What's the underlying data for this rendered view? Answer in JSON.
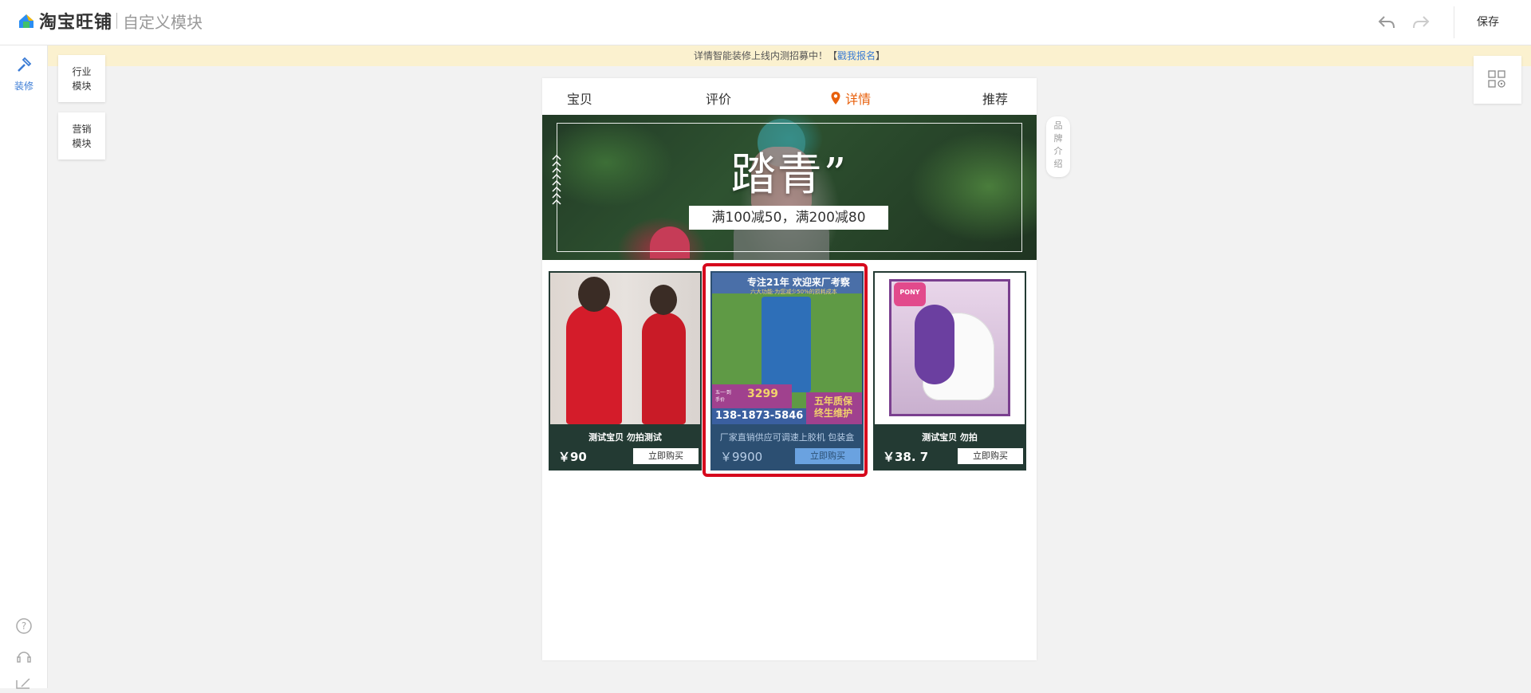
{
  "app": {
    "brand": "淘宝旺铺",
    "subtitle": "自定义模块",
    "save_label": "保存"
  },
  "left_nav": {
    "decorate_label": "装修"
  },
  "notice": {
    "text": "详情智能装修上线内测招募中！【",
    "link": "戳我报名",
    "suffix": "】"
  },
  "modules": {
    "industry": "行业模块",
    "marketing": "营销模块"
  },
  "tabs": [
    {
      "label": "宝贝"
    },
    {
      "label": "评价"
    },
    {
      "label": "详情"
    },
    {
      "label": "推荐"
    }
  ],
  "banner": {
    "title": "踏青”",
    "promo": "满100减50，满200减80"
  },
  "brand_intro": "品牌介绍",
  "products": [
    {
      "name": "测试宝贝  勿拍测试",
      "price": "￥90",
      "buy": "立即购买"
    },
    {
      "name": "厂家直销供应可调速上胶机  包装盒",
      "price": "￥9900",
      "buy": "立即购买",
      "ad": {
        "headline": "专注21年 欢迎来厂考察",
        "sub": "六大功能·为您减少50%的损耗成本",
        "price": "3299",
        "price_tag": "五一·到手价",
        "phone": "138-1873-5846",
        "warranty": "五年质保",
        "service": "终生维护"
      }
    },
    {
      "name": "测试宝贝  勿拍",
      "price": "￥38. 7",
      "buy": "立即购买",
      "box_label": "PONY"
    }
  ],
  "colors": {
    "accent": "#e8600c",
    "link": "#3a7bd5",
    "selection": "#d6081d",
    "card_bg": "#233a33",
    "notice_bg": "#fbf1cf"
  }
}
